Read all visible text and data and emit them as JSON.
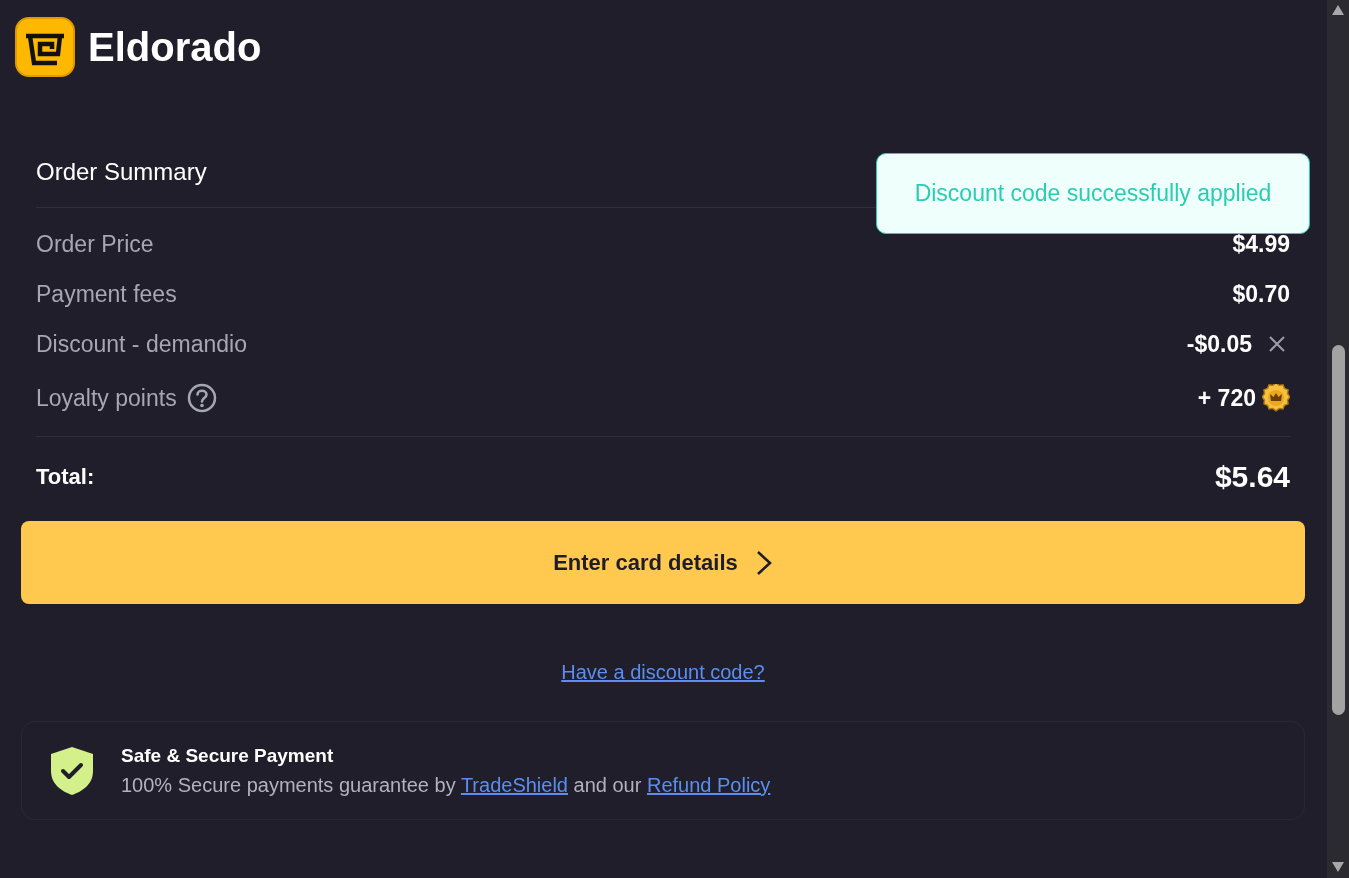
{
  "header": {
    "logo_text": "Eldorado"
  },
  "toast": {
    "message": "Discount code successfully applied"
  },
  "order_summary": {
    "title": "Order Summary",
    "rows": [
      {
        "kind": "plain",
        "label": "Order Price",
        "value": "$4.99"
      },
      {
        "kind": "plain",
        "label": "Payment fees",
        "value": "$0.70"
      },
      {
        "kind": "removable",
        "label": "Discount - demandio",
        "value": "-$0.05"
      },
      {
        "kind": "points",
        "label": "Loyalty points",
        "value": "+ 720"
      }
    ],
    "total": {
      "label": "Total:",
      "value": "$5.64"
    }
  },
  "primary_button": {
    "label": "Enter card details"
  },
  "discount_link": "Have a discount code?",
  "secure_payment": {
    "title": "Safe & Secure Payment",
    "text": [
      {
        "kind": "text",
        "text": "100% Secure payments guarantee by"
      },
      {
        "kind": "link",
        "text": "TradeShield"
      },
      {
        "kind": "text",
        "text": "and our"
      },
      {
        "kind": "link",
        "text": "Refund Policy"
      }
    ]
  }
}
